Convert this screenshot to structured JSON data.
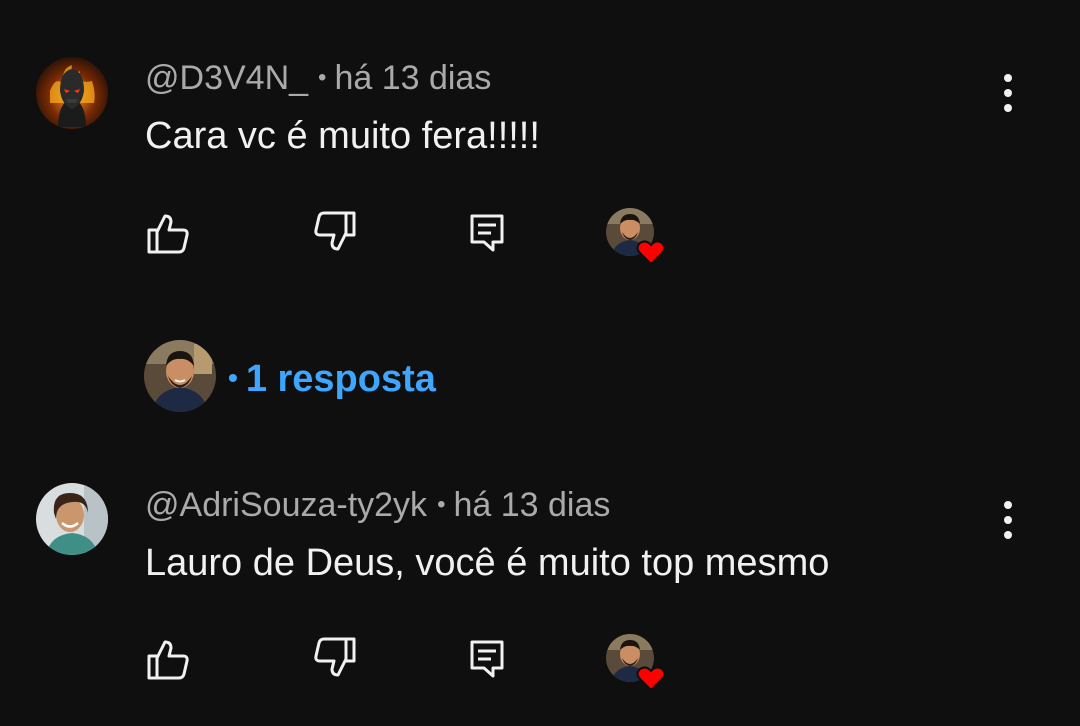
{
  "comments": [
    {
      "author": "@D3V4N_",
      "age": "há 13 dias",
      "text": "Cara vc é muito fera!!!!!",
      "avatar_icon": "dark-masked-figure-avatar"
    },
    {
      "author": "@AdriSouza-ty2yk",
      "age": "há 13 dias",
      "text": "Lauro de Deus, você é muito top mesmo",
      "avatar_icon": "woman-avatar"
    }
  ],
  "separator": "•",
  "replies": {
    "label": "1 resposta",
    "separator": "•"
  },
  "colors": {
    "background": "#0f0f0f",
    "text": "#f1f1f1",
    "meta": "#aaaaaa",
    "link": "#3ea6ff",
    "heart": "#ff0000"
  }
}
